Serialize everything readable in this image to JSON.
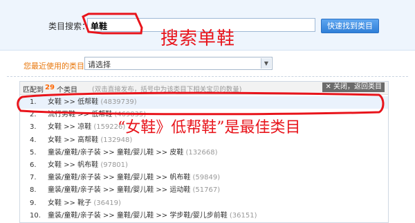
{
  "search": {
    "label": "类目搜索：",
    "value": "单鞋",
    "button_label": "快速找到类目"
  },
  "annotation_top": "搜索单鞋",
  "recent": {
    "label": "您最近使用的类目：",
    "selected": "请选择"
  },
  "results": {
    "found_label": "匹配到",
    "count": "29",
    "unit": "个类目",
    "hint": "(双击直接发布，括号中为该类目下相关宝贝的数量)",
    "close_label": "关闭，返回类目",
    "items": [
      {
        "num": "1.",
        "path": "女鞋 >> 低帮鞋",
        "count": "(4839739)"
      },
      {
        "num": "2.",
        "path": "流行男鞋 >> 低帮鞋",
        "count": "(469835)"
      },
      {
        "num": "3.",
        "path": "女鞋 >> 凉鞋",
        "count": "(159226)"
      },
      {
        "num": "4.",
        "path": "女鞋 >> 高帮鞋",
        "count": "(132948)"
      },
      {
        "num": "5.",
        "path": "童装/童鞋/亲子装 >> 童鞋/婴儿鞋 >> 皮鞋",
        "count": "(132668)"
      },
      {
        "num": "6.",
        "path": "女鞋 >> 帆布鞋",
        "count": "(97801)"
      },
      {
        "num": "7.",
        "path": "童装/童鞋/亲子装 >> 童鞋/婴儿鞋 >> 帆布鞋",
        "count": "(59849)"
      },
      {
        "num": "8.",
        "path": "童装/童鞋/亲子装 >> 童鞋/婴儿鞋 >> 运动鞋",
        "count": "(51767)"
      },
      {
        "num": "9.",
        "path": "女鞋 >> 靴子",
        "count": "(36419)"
      },
      {
        "num": "10.",
        "path": "童装/童鞋/亲子装 >> 童鞋/婴儿鞋 >> 学步鞋/婴儿步前鞋",
        "count": "(36151)"
      }
    ]
  },
  "annotation_right": "“女鞋》低帮鞋”是最佳类目",
  "colors": {
    "annotation_red": "#e8141b",
    "count_orange": "#ff6600",
    "button_blue": "#3a8be0"
  }
}
